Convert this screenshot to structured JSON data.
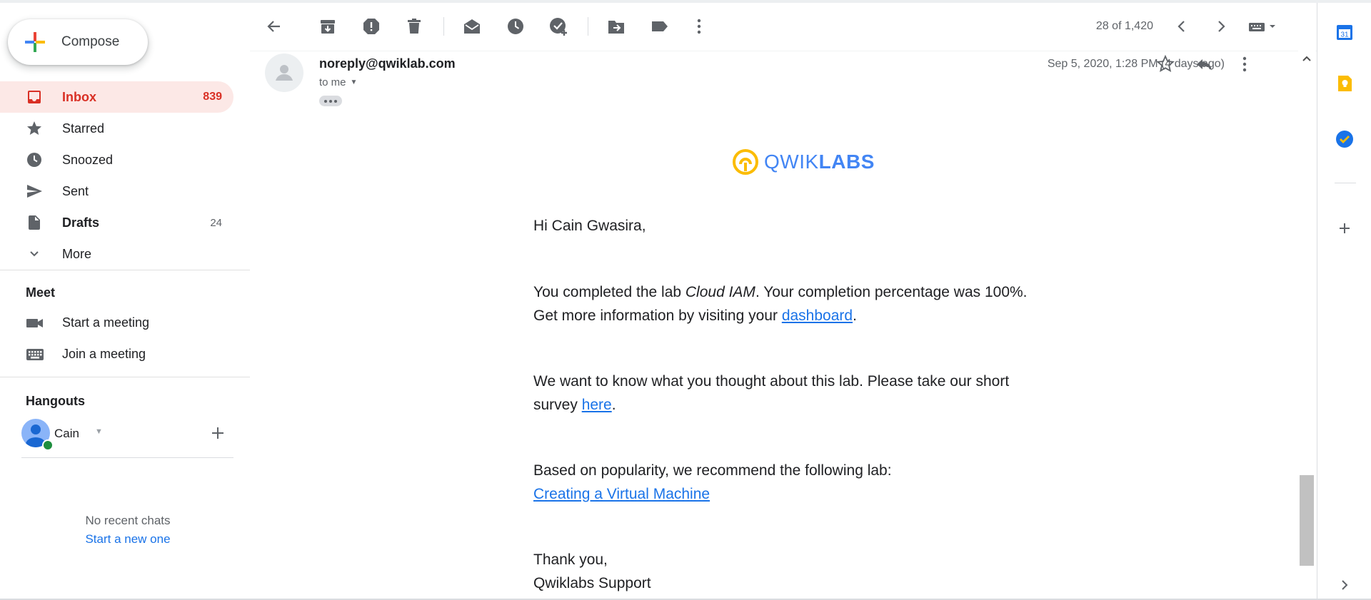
{
  "compose": {
    "label": "Compose"
  },
  "nav": [
    {
      "label": "Inbox",
      "count": "839",
      "icon": "inbox-icon"
    },
    {
      "label": "Starred",
      "count": "",
      "icon": "star-icon"
    },
    {
      "label": "Snoozed",
      "count": "",
      "icon": "clock-icon"
    },
    {
      "label": "Sent",
      "count": "",
      "icon": "send-icon"
    },
    {
      "label": "Drafts",
      "count": "24",
      "icon": "draft-icon"
    },
    {
      "label": "More",
      "count": "",
      "icon": "chevron-down-icon"
    }
  ],
  "meet": {
    "title": "Meet",
    "start": "Start a meeting",
    "join": "Join a meeting"
  },
  "hangouts": {
    "title": "Hangouts",
    "user": "Cain",
    "no_chats": "No recent chats",
    "new_chat": "Start a new one"
  },
  "toolbar": {
    "pager": "28 of 1,420"
  },
  "message": {
    "sender": "noreply@qwiklab.com",
    "to": "to me",
    "date": "Sep 5, 2020, 1:28 PM (4 days ago)",
    "logo_light": "QWIK",
    "logo_bold": "LABS",
    "greeting": "Hi Cain Gwasira,",
    "p1_pre": "You completed the lab ",
    "p1_em": "Cloud IAM",
    "p1_post": ". Your completion percentage was 100%.",
    "p1_line2_pre": "Get more information by visiting your ",
    "p1_link": "dashboard",
    "p1_line2_post": ".",
    "p2_pre": "We want to know what you thought about this lab. Please take our short",
    "p2_line2_pre": "survey ",
    "p2_link": "here",
    "p2_line2_post": ".",
    "p3": "Based on popularity, we recommend the following lab:",
    "p3_link": "Creating a Virtual Machine",
    "signoff": "Thank you,",
    "signature": "Qwiklabs Support"
  },
  "colors": {
    "accent_red": "#d93025",
    "active_bg": "#fce8e6",
    "link_blue": "#1a73e8",
    "logo_blue": "#4285f4",
    "logo_yellow": "#fbbc04"
  }
}
